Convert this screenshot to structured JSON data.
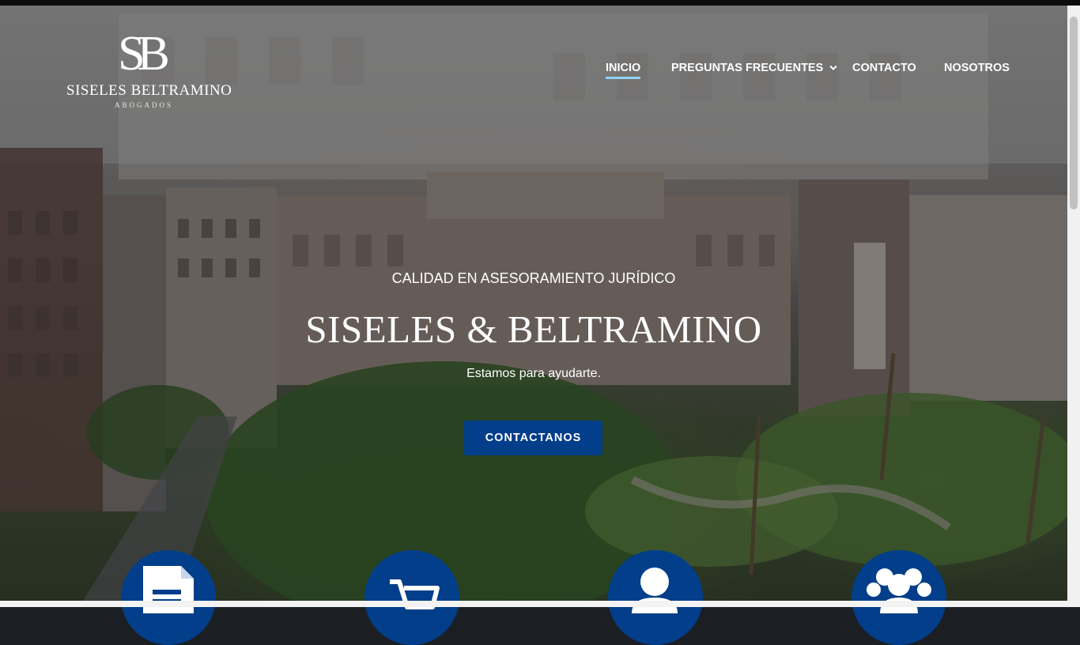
{
  "brand": {
    "mark": "SB",
    "name": "SISELES BELTRAMINO",
    "sub": "ABOGADOS"
  },
  "nav": {
    "items": [
      {
        "label": "INICIO",
        "active": true
      },
      {
        "label": "PREGUNTAS FRECUENTES",
        "has_dropdown": true
      },
      {
        "label": "CONTACTO"
      },
      {
        "label": "NOSOTROS"
      }
    ]
  },
  "hero": {
    "subtitle": "CALIDAD EN ASESORAMIENTO JURÍDICO",
    "title": "SISELES & BELTRAMINO",
    "tagline": "Estamos para ayudarte.",
    "cta_label": "CONTACTANOS"
  },
  "features": [
    {
      "icon": "document-icon"
    },
    {
      "icon": "cart-icon"
    },
    {
      "icon": "person-icon"
    },
    {
      "icon": "group-icon"
    }
  ],
  "colors": {
    "accent": "#023e8a",
    "nav_active_underline": "#8fd3f5",
    "overlay": "rgba(10,12,18,0.42)"
  }
}
